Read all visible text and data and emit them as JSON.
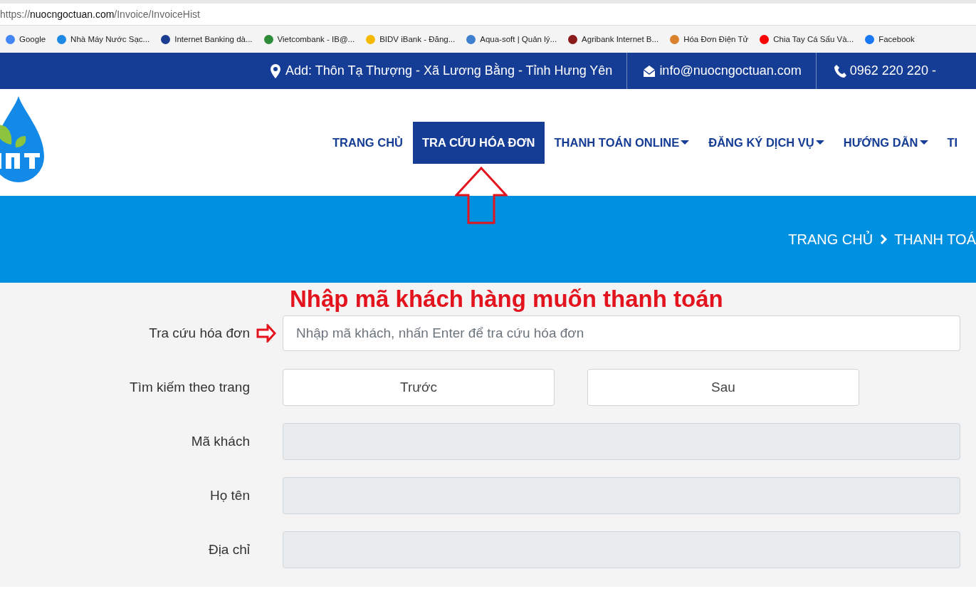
{
  "browser": {
    "url_scheme": "https://",
    "url_host": "nuocngoctuan.com",
    "url_path": "/Invoice/InvoiceHist"
  },
  "bookmarks": [
    {
      "label": "Google",
      "color": "#4285f4"
    },
    {
      "label": "Nhà Máy Nước Sạc...",
      "color": "#1e88e5"
    },
    {
      "label": "Internet Banking dà...",
      "color": "#1a3d8f"
    },
    {
      "label": "Vietcombank - IB@...",
      "color": "#2e8b3a"
    },
    {
      "label": "BIDV iBank - Đăng...",
      "color": "#f5b800"
    },
    {
      "label": "Aqua-soft | Quản lý...",
      "color": "#3f7fd0"
    },
    {
      "label": "Agribank Internet B...",
      "color": "#8b1a1a"
    },
    {
      "label": "Hóa Đơn Điện Tử",
      "color": "#d9822b"
    },
    {
      "label": "Chia Tay Cá Sấu Và...",
      "color": "#ff0000"
    },
    {
      "label": "Facebook",
      "color": "#1877f2"
    }
  ],
  "topbar": [
    {
      "kind": "pin",
      "text": "Add: Thôn Tạ Thượng - Xã Lương Bằng - Tỉnh Hưng Yên"
    },
    {
      "kind": "mail",
      "text": "info@nuocngoctuan.com"
    },
    {
      "kind": "phone",
      "text": "0962 220 220 -"
    }
  ],
  "nav": [
    {
      "label": "TRANG CHỦ",
      "selected": false,
      "dropdown": false
    },
    {
      "label": "TRA CỨU HÓA ĐƠN",
      "selected": true,
      "dropdown": false
    },
    {
      "label": "THANH TOÁN ONLINE",
      "selected": false,
      "dropdown": true
    },
    {
      "label": "ĐĂNG KÝ DỊCH VỤ",
      "selected": false,
      "dropdown": true
    },
    {
      "label": "HƯỚNG DẪN",
      "selected": false,
      "dropdown": true
    },
    {
      "label": "TI",
      "selected": false,
      "dropdown": false
    }
  ],
  "breadcrumb": [
    "TRANG CHỦ",
    "THANH TOÁ"
  ],
  "annotation": "Nhập mã khách hàng muốn thanh toán",
  "form": [
    {
      "kind": "search",
      "label": "Tra cứu hóa đơn",
      "placeholder": "Nhập mã khách, nhấn Enter để tra cứu hóa đơn"
    },
    {
      "kind": "pager",
      "label": "Tìm kiếm theo trang",
      "buttons": [
        "Trước",
        "Sau"
      ]
    },
    {
      "kind": "readonly",
      "label": "Mã khách"
    },
    {
      "kind": "readonly",
      "label": "Họ tên"
    },
    {
      "kind": "readonly",
      "label": "Địa chỉ"
    }
  ]
}
